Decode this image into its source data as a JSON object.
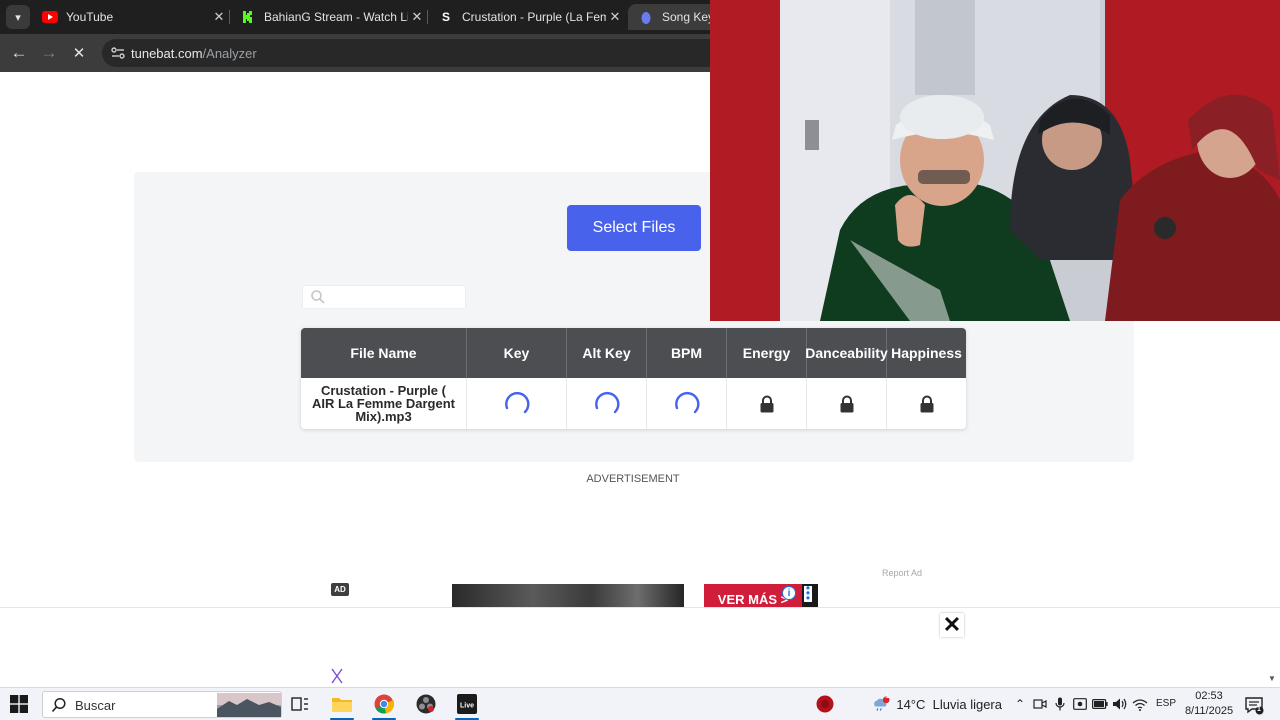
{
  "browser": {
    "tabs": [
      {
        "title": "YouTube",
        "favicon": "youtube-icon",
        "active": false
      },
      {
        "title": "BahianG Stream - Watch Live on",
        "favicon": "kick-icon",
        "active": false
      },
      {
        "title": "Crustation - Purple (La Femme D",
        "favicon": "songbpm-icon",
        "active": false
      },
      {
        "title": "Song Key &",
        "favicon": "tunebat-icon",
        "active": true
      }
    ],
    "url_host": "tunebat.com",
    "url_path": "/Analyzer"
  },
  "analyzer": {
    "select_files_label": "Select Files",
    "search_placeholder": "",
    "columns": [
      "File Name",
      "Key",
      "Alt Key",
      "BPM",
      "Energy",
      "Danceability",
      "Happiness"
    ],
    "row": {
      "file_name": "Crustation - Purple ( AIR La Femme Dargent Mix).mp3",
      "key": "loading",
      "alt_key": "loading",
      "bpm": "loading",
      "energy": "locked",
      "danceability": "locked",
      "happiness": "locked"
    }
  },
  "ads": {
    "advertisement_label": "ADVERTISEMENT",
    "report_ad_label": "Report Ad",
    "ad_badge": "AD",
    "banner_cta": "VER MÁS >",
    "info_icon": "i"
  },
  "taskbar": {
    "search_placeholder": "Buscar",
    "weather": "14°C  Lluvia ligera",
    "weather_alert_count": "1",
    "language": "ESP",
    "time": "02:53",
    "date": "8/11/2025",
    "notification_count": "1"
  },
  "colors": {
    "accent_blue": "#4862ec",
    "table_header": "#4c4e52",
    "spinner": "#4862ec",
    "ad_red": "#d01e3a"
  }
}
